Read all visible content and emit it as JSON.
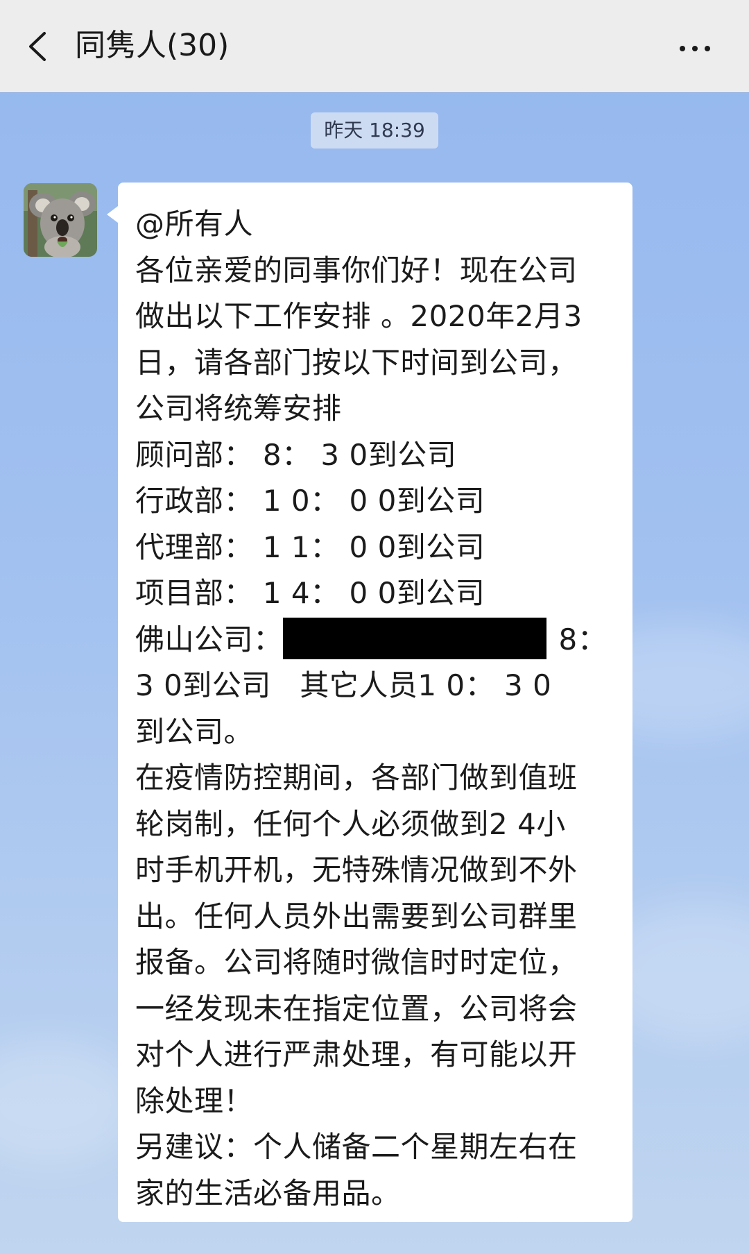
{
  "header": {
    "title": "同隽人(30)",
    "back_icon": "chevron-left-icon",
    "more_icon": "more-dots-icon"
  },
  "timestamp": "昨天 18:39",
  "avatar_icon": "koala-avatar",
  "message": {
    "lines": [
      "@所有人",
      "各位亲爱的同事你们好！现在公司",
      "做出以下工作安排 。2020年2月3",
      "日，请各部门按以下时间到公司，",
      "公司将统筹安排",
      "顾问部： 8： 3 0到公司",
      "行政部： 1 0： 0 0到公司",
      "代理部： 1 1： 0 0到公司",
      "项目部： 1 4： 0 0到公司",
      "佛山公司：",
      "8：",
      "3 0到公司   其它人员1 0： 3 0",
      "到公司。",
      "在疫情防控期间，各部门做到值班",
      "轮岗制，任何个人必须做到2 4小",
      "时手机开机，无特殊情况做到不外",
      "出。任何人员外出需要到公司群里",
      "报备。公司将随时微信时时定位，",
      "一经发现未在指定位置，公司将会",
      "对个人进行严肃处理，有可能以开",
      "除处理！",
      "另建议：个人储备二个星期左右在",
      "家的生活必备用品。"
    ]
  },
  "colors": {
    "header_bg": "#ededed",
    "chat_bg": "#a2c1f0",
    "bubble_bg": "#ffffff",
    "text": "#1b1b1b"
  }
}
